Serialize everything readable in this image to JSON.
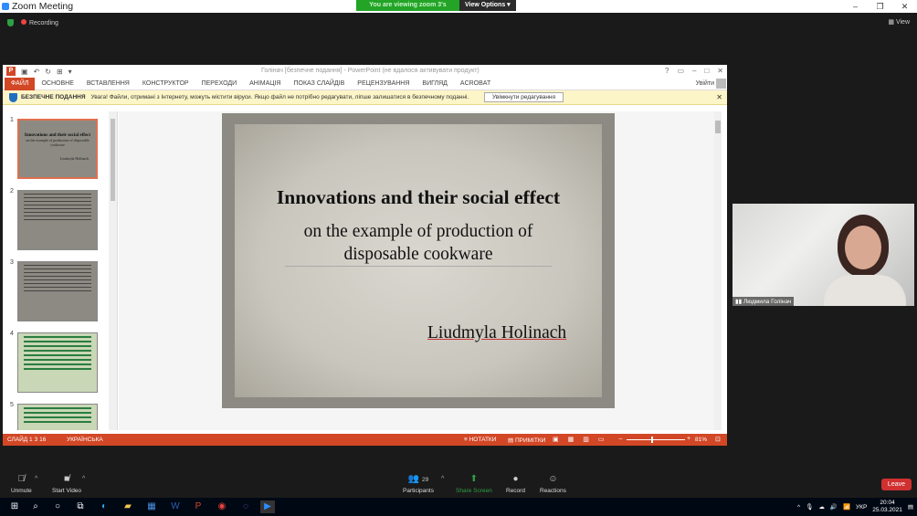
{
  "zoom": {
    "title": "Zoom Meeting",
    "share_banner": "You are viewing zoom 3's screen",
    "view_options": "View Options",
    "recording": "Recording",
    "view": "View",
    "window_controls": [
      "–",
      "❐",
      "✕"
    ]
  },
  "ppt": {
    "doc_title": "Голінач [безпечне подання] - PowerPoint (не вдалося активувати продукт)",
    "title_controls": [
      "?",
      "▭",
      "–",
      "□",
      "✕"
    ],
    "tabs": [
      "ФАЙЛ",
      "ОСНОВНЕ",
      "ВСТАВЛЕННЯ",
      "КОНСТРУКТОР",
      "ПЕРЕХОДИ",
      "АНІМАЦІЯ",
      "ПОКАЗ СЛАЙДІВ",
      "РЕЦЕНЗУВАННЯ",
      "ВИГЛЯД",
      "ACROBAT"
    ],
    "signin": "Увійти",
    "protected": {
      "label": "БЕЗПЕЧНЕ ПОДАННЯ",
      "message": "Увага! Файли, отримані з Інтернету, можуть містити віруси. Якщо файл не потрібно редагувати, ліпше залишатися в безпечному поданні.",
      "enable": "Увімкнути редагування",
      "close": "✕"
    },
    "thumbs": [
      {
        "num": "1",
        "title": "Innovations and their social effect",
        "sub": "on the example of production of disposable cookware",
        "author": "Liudmyla Holinach"
      },
      {
        "num": "2"
      },
      {
        "num": "3"
      },
      {
        "num": "4"
      },
      {
        "num": "5"
      }
    ],
    "slide": {
      "title": "Innovations and their social effect",
      "subtitle1": "on the example of production of",
      "subtitle2": "disposable cookware",
      "author": "Liudmyla Holinach"
    },
    "status": {
      "slide": "СЛАЙД 1 З 16",
      "language": "УКРАЇНСЬКА",
      "notes": "НОТАТКИ",
      "comments": "ПРИМІТКИ",
      "zoom": "81%",
      "zoom_level": 0.42
    }
  },
  "participant": {
    "name": "Людмила Голінач"
  },
  "toolbar": {
    "unmute": "Unmute",
    "start_video": "Start Video",
    "participants": "Participants",
    "participants_count": "29",
    "share_screen": "Share Screen",
    "record": "Record",
    "reactions": "Reactions",
    "leave": "Leave"
  },
  "taskbar": {
    "lang": "УКР",
    "time": "20:04",
    "date": "25.03.2021"
  }
}
